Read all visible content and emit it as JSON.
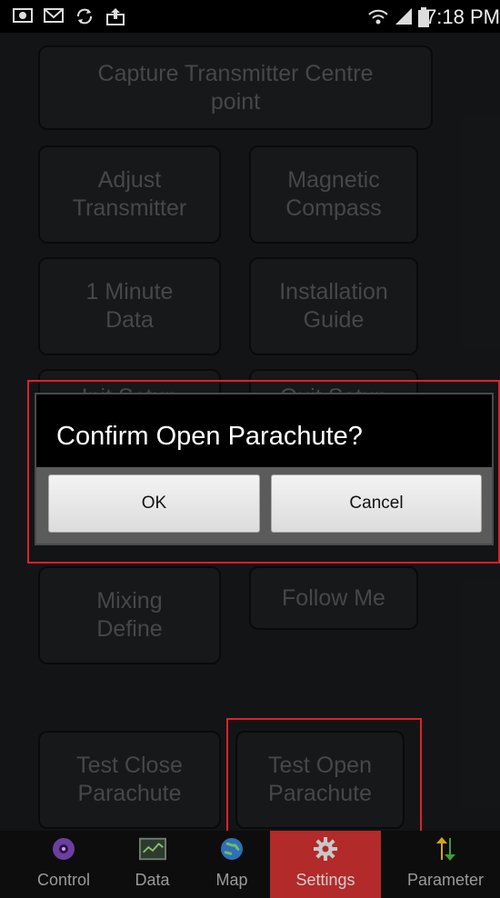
{
  "status_bar": {
    "time": "7:18 PM",
    "left_icons": [
      "image-icon",
      "gmail-icon",
      "sync-icon",
      "upload-icon"
    ],
    "right_icons": [
      "wifi-icon",
      "signal-icon",
      "battery-icon"
    ]
  },
  "tiles": {
    "capture": [
      "Capture Transmitter Centre",
      "point"
    ],
    "adjust": [
      "Adjust",
      "Transmitter"
    ],
    "compass": [
      "Magnetic",
      "Compass"
    ],
    "minute_data": [
      "1 Minute",
      "Data"
    ],
    "install": [
      "Installation",
      "Guide"
    ],
    "init_setup": [
      "Init Setup"
    ],
    "quit_setup": [
      "Quit Setup"
    ],
    "mixing": [
      "Mixing",
      "Define"
    ],
    "follow": [
      "Follow Me"
    ],
    "close_chute": [
      "Test Close",
      "Parachute"
    ],
    "open_chute": [
      "Test Open",
      "Parachute"
    ]
  },
  "dialog": {
    "title": "Confirm Open Parachute?",
    "ok_label": "OK",
    "cancel_label": "Cancel"
  },
  "bottom_nav": {
    "items": [
      {
        "label": "Control",
        "icon": "drone-icon"
      },
      {
        "label": "Data",
        "icon": "monitor-icon"
      },
      {
        "label": "Map",
        "icon": "globe-icon"
      },
      {
        "label": "Settings",
        "icon": "gear-icon"
      },
      {
        "label": "Parameter",
        "icon": "arrows-icon"
      }
    ],
    "active": "Settings"
  },
  "colors": {
    "screen_bg": "#232628",
    "tile_bg": "#2a2d2f",
    "tile_text": "#7f8183",
    "highlight_red": "#e0202a",
    "active_tab": "#b22a2a"
  }
}
